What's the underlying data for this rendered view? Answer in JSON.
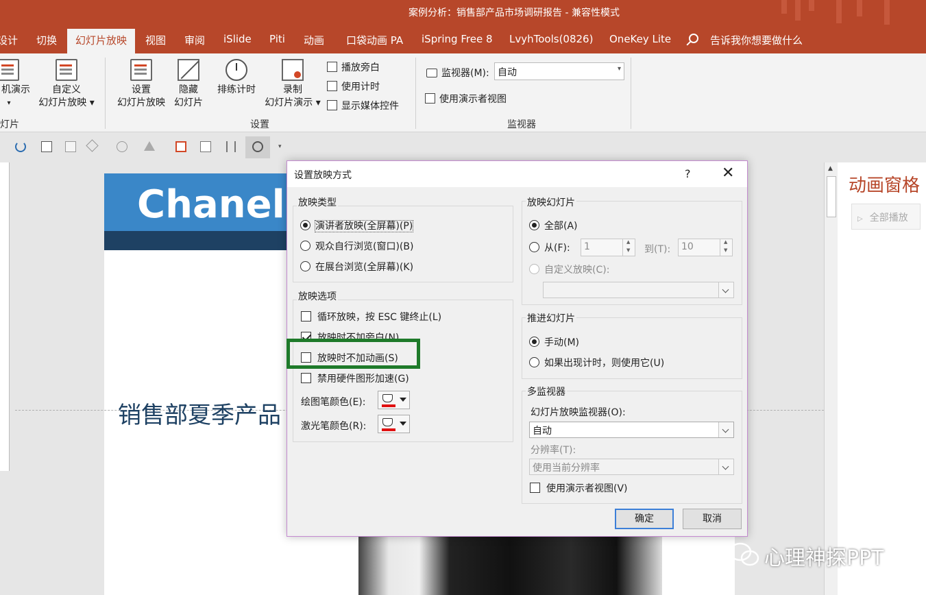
{
  "window": {
    "title": "案例分析：销售部产品市场调研报告 - 兼容性模式"
  },
  "tabs": [
    {
      "label": "设计"
    },
    {
      "label": "切换"
    },
    {
      "label": "幻灯片放映"
    },
    {
      "label": "视图"
    },
    {
      "label": "审阅"
    },
    {
      "label": "iSlide"
    },
    {
      "label": "Piti"
    },
    {
      "label": "动画"
    },
    {
      "label": "口袋动画 PA"
    },
    {
      "label": "iSpring Free 8"
    },
    {
      "label": "LvyhTools(0826)"
    },
    {
      "label": "OneKey Lite"
    }
  ],
  "tell_me": "告诉我你想要做什么",
  "ribbon": {
    "online_line1": "机演示",
    "online_line2": "▾",
    "custom_line1": "自定义",
    "custom_line2": "幻灯片放映 ▾",
    "group_slides_partial": "灯片",
    "setup_line1": "设置",
    "setup_line2": "幻灯片放映",
    "hide_line1": "隐藏",
    "hide_line2": "幻灯片",
    "rehearse": "排练计时",
    "record_line1": "录制",
    "record_line2": "幻灯片演示 ▾",
    "play_narration": "播放旁白",
    "use_timings": "使用计时",
    "show_media": "显示媒体控件",
    "group_setup": "设置",
    "monitor_label": "监视器(M):",
    "monitor_value": "自动",
    "presenter_view": "使用演示者视图",
    "group_monitors": "监视器"
  },
  "slide": {
    "title": "Chanel",
    "subtitle": "销售部夏季产品"
  },
  "animation_pane": {
    "title": "动画窗格",
    "play_all": "全部播放"
  },
  "dialog": {
    "title": "设置放映方式",
    "help": "?",
    "close": "✕",
    "show_type": {
      "label": "放映类型",
      "options": [
        "演讲者放映(全屏幕)(P)",
        "观众自行浏览(窗口)(B)",
        "在展台浏览(全屏幕)(K)"
      ],
      "selected": "演讲者放映(全屏幕)(P)"
    },
    "show_options": {
      "label": "放映选项",
      "loop": {
        "label": "循环放映，按 ESC 键终止(L)",
        "checked": false
      },
      "no_narration": {
        "label": "放映时不加旁白(N)",
        "checked": true
      },
      "no_animation": {
        "label": "放映时不加动画(S)",
        "checked": false
      },
      "disable_hw": {
        "label": "禁用硬件图形加速(G)",
        "checked": false
      },
      "pen_color_label": "绘图笔颜色(E):",
      "laser_color_label": "激光笔颜色(R):",
      "pen_color": "#e01010",
      "laser_color": "#e01010"
    },
    "show_slides": {
      "label": "放映幻灯片",
      "all": "全部(A)",
      "from": "从(F):",
      "from_value": "1",
      "to": "到(T):",
      "to_value": "10",
      "custom": "自定义放映(C):",
      "selected": "全部(A)"
    },
    "advance": {
      "label": "推进幻灯片",
      "manual": "手动(M)",
      "timings": "如果出现计时，则使用它(U)",
      "selected": "手动(M)"
    },
    "multi_monitor": {
      "label": "多监视器",
      "monitor_label": "幻灯片放映监视器(O):",
      "monitor_value": "自动",
      "resolution_label": "分辨率(T):",
      "resolution_value": "使用当前分辨率",
      "presenter_view": "使用演示者视图(V)",
      "presenter_checked": false
    },
    "ok": "确定",
    "cancel": "取消"
  },
  "watermark": "心理神探PPT",
  "accent_color": "#b7472a",
  "highlight_color": "#1e7a2a"
}
